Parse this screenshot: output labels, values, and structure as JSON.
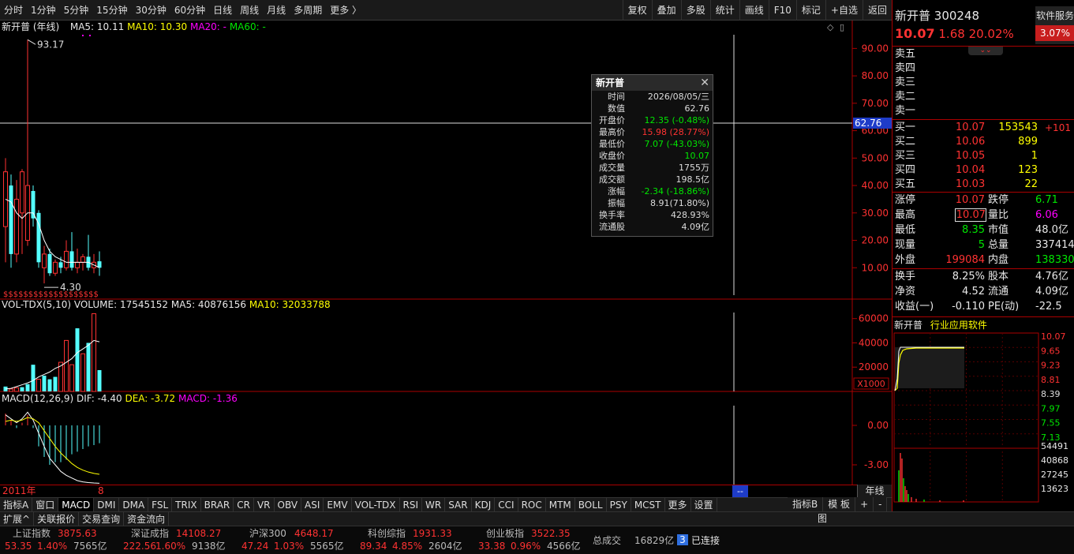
{
  "toolbar": {
    "left": [
      "分时",
      "1分钟",
      "5分钟",
      "15分钟",
      "30分钟",
      "60分钟",
      "日线",
      "周线",
      "月线",
      "多周期",
      "更多 〉"
    ],
    "right": [
      "复权",
      "叠加",
      "多股",
      "统计",
      "画线",
      "F10",
      "标记",
      "+自选",
      "返回"
    ]
  },
  "kline": {
    "title": "新开普 (年线)",
    "ma5": "MA5: 10.11",
    "ma10": "MA10: 10.30",
    "ma20": "MA20: -",
    "ma60": "MA60: -",
    "high_label": "93.17",
    "low_label": "4.30",
    "y_ticks": [
      "90.00",
      "80.00",
      "70.00",
      "60.00",
      "50.00",
      "40.00",
      "30.00",
      "20.00",
      "10.00"
    ],
    "crosshair_value": "62.76",
    "s_marks": "$$$$$$$$$$$$$$$$$$$"
  },
  "volume": {
    "title": "VOL-TDX(5,10)",
    "volume": "VOLUME: 17545152",
    "ma5": "MA5: 40876156",
    "ma10": "MA10: 32033788",
    "y_ticks": [
      "60000",
      "40000",
      "20000"
    ],
    "unit": "X1000"
  },
  "macd": {
    "title": "MACD(12,26,9)",
    "dif": "DIF: -4.40",
    "dea": "DEA: -3.72",
    "macd": "MACD: -1.36",
    "y_ticks": [
      "0.00",
      "-3.00"
    ]
  },
  "period": {
    "start_year": "2011年",
    "mid_label": "8",
    "cursor_label": "--",
    "period_button": "年线"
  },
  "tooltip": {
    "title": "新开普",
    "close": "✕",
    "rows": [
      {
        "k": "时间",
        "v": "2026/08/05/三",
        "c": "white"
      },
      {
        "k": "数值",
        "v": "62.76",
        "c": "white"
      },
      {
        "k": "开盘价",
        "v": "12.35 (-0.48%)",
        "c": "green"
      },
      {
        "k": "最高价",
        "v": "15.98 (28.77%)",
        "c": "red"
      },
      {
        "k": "最低价",
        "v": "7.07 (-43.03%)",
        "c": "green"
      },
      {
        "k": "收盘价",
        "v": "10.07",
        "c": "green"
      },
      {
        "k": "成交量",
        "v": "1755万",
        "c": "white"
      },
      {
        "k": "成交额",
        "v": "198.5亿",
        "c": "white"
      },
      {
        "k": "涨幅",
        "v": "-2.34 (-18.86%)",
        "c": "green"
      },
      {
        "k": "振幅",
        "v": "8.91(71.80%)",
        "c": "white"
      },
      {
        "k": "换手率",
        "v": "428.93%",
        "c": "white"
      },
      {
        "k": "流通股",
        "v": "4.09亿",
        "c": "white"
      }
    ]
  },
  "indicator_tabs": [
    "指标A",
    "窗口",
    "MACD",
    "DMI",
    "DMA",
    "FSL",
    "TRIX",
    "BRAR",
    "CR",
    "VR",
    "OBV",
    "ASI",
    "EMV",
    "VOL-TDX",
    "RSI",
    "WR",
    "SAR",
    "KDJ",
    "CCI",
    "ROC",
    "MTM",
    "BOLL",
    "PSY",
    "MCST",
    "更多",
    "设置"
  ],
  "indicator_right": [
    "指标B",
    "模 板",
    "+",
    "-"
  ],
  "bottom_tabs": [
    "扩展^",
    "关联报价",
    "交易查询",
    "资金流向"
  ],
  "bottom_icon": "图",
  "stock": {
    "name": "新开普",
    "code": "300248",
    "service": "软件服务",
    "service_pct": "3.07%",
    "price": "10.07",
    "change": "1.68",
    "change_pct": "20.02%"
  },
  "asks": [
    {
      "label": "卖五"
    },
    {
      "label": "卖四"
    },
    {
      "label": "卖三"
    },
    {
      "label": "卖二"
    },
    {
      "label": "卖一"
    }
  ],
  "bids": [
    {
      "label": "买一",
      "price": "10.07",
      "vol": "153543",
      "extra": "+101"
    },
    {
      "label": "买二",
      "price": "10.06",
      "vol": "899",
      "extra": ""
    },
    {
      "label": "买三",
      "price": "10.05",
      "vol": "1",
      "extra": ""
    },
    {
      "label": "买四",
      "price": "10.04",
      "vol": "123",
      "extra": ""
    },
    {
      "label": "买五",
      "price": "10.03",
      "vol": "22",
      "extra": ""
    }
  ],
  "stats": [
    {
      "k1": "涨停",
      "v1": "10.07",
      "c1": "red",
      "k2": "跌停",
      "v2": "6.71",
      "c2": "green"
    },
    {
      "k1": "最高",
      "v1": "10.07",
      "c1": "red",
      "k2": "量比",
      "v2": "6.06",
      "c2": "magenta"
    },
    {
      "k1": "最低",
      "v1": "8.35",
      "c1": "green",
      "k2": "市值",
      "v2": "48.0亿",
      "c2": "white"
    },
    {
      "k1": "现量",
      "v1": "5",
      "c1": "green",
      "k2": "总量",
      "v2": "337414",
      "c2": "white"
    },
    {
      "k1": "外盘",
      "v1": "199084",
      "c1": "red",
      "k2": "内盘",
      "v2": "138330",
      "c2": "green"
    }
  ],
  "stats2": [
    {
      "k1": "换手",
      "v1": "8.25%",
      "k2": "股本",
      "v2": "4.76亿"
    },
    {
      "k1": "净资",
      "v1": "4.52",
      "k2": "流通",
      "v2": "4.09亿"
    },
    {
      "k1": "收益(一)",
      "v1": "-0.110",
      "k2": "PE(动)",
      "v2": "-22.5"
    }
  ],
  "mini": {
    "name": "新开普",
    "industry": "行业应用软件",
    "price_ticks": [
      {
        "v": "10.07",
        "c": "red"
      },
      {
        "v": "9.65",
        "c": "red"
      },
      {
        "v": "9.23",
        "c": "red"
      },
      {
        "v": "8.81",
        "c": "red"
      },
      {
        "v": "8.39",
        "c": "white"
      },
      {
        "v": "7.97",
        "c": "green"
      },
      {
        "v": "7.55",
        "c": "green"
      },
      {
        "v": "7.13",
        "c": "green"
      }
    ],
    "vol_ticks": [
      "54491",
      "40868",
      "27245",
      "13623"
    ]
  },
  "indices": [
    {
      "name": "上证指数",
      "value": "3875.63",
      "chg": "53.35",
      "pct": "1.40%",
      "amt": "7565亿"
    },
    {
      "name": "深证成指",
      "value": "14108.27",
      "chg": "222.56",
      "pct": "1.60%",
      "amt": "9138亿"
    },
    {
      "name": "沪深300",
      "value": "4648.17",
      "chg": "47.24",
      "pct": "1.03%",
      "amt": "5565亿"
    },
    {
      "name": "科创综指",
      "value": "1931.33",
      "chg": "89.34",
      "pct": "4.85%",
      "amt": "2604亿"
    },
    {
      "name": "创业板指",
      "value": "3522.35",
      "chg": "33.38",
      "pct": "0.96%",
      "amt": "4566亿"
    }
  ],
  "total": {
    "label": "总成交",
    "value": "16829亿"
  },
  "connection": {
    "count": "3",
    "label": "已连接"
  },
  "chart_data": {
    "type": "candlestick",
    "price_range": [
      0,
      95
    ],
    "volume_range": [
      0,
      65000
    ],
    "macd_range": [
      -4.5,
      1.5
    ],
    "candles": [
      {
        "o": 25,
        "c": 45,
        "h": 50,
        "l": 12,
        "up": true
      },
      {
        "o": 40,
        "c": 15,
        "h": 44,
        "l": 10,
        "up": false
      },
      {
        "o": 15,
        "c": 35,
        "h": 42,
        "l": 12,
        "up": true
      },
      {
        "o": 30,
        "c": 45,
        "h": 46,
        "l": 15,
        "up": true
      },
      {
        "o": 20,
        "c": 40,
        "h": 93.17,
        "l": 18,
        "up": true
      },
      {
        "o": 38,
        "c": 28,
        "h": 40,
        "l": 25,
        "up": false
      },
      {
        "o": 30,
        "c": 12,
        "h": 31,
        "l": 10,
        "up": false
      },
      {
        "o": 10,
        "c": 15,
        "h": 18,
        "l": 4.3,
        "up": true
      },
      {
        "o": 15,
        "c": 8,
        "h": 17,
        "l": 7,
        "up": false
      },
      {
        "o": 8,
        "c": 12,
        "h": 13,
        "l": 7,
        "up": true
      },
      {
        "o": 12,
        "c": 10,
        "h": 14,
        "l": 8,
        "up": false
      },
      {
        "o": 10,
        "c": 16,
        "h": 20,
        "l": 9,
        "up": true
      },
      {
        "o": 16,
        "c": 10,
        "h": 23,
        "l": 9,
        "up": false
      },
      {
        "o": 10,
        "c": 12,
        "h": 17,
        "l": 8,
        "up": true
      },
      {
        "o": 12,
        "c": 14,
        "h": 15,
        "l": 9,
        "up": true
      },
      {
        "o": 14,
        "c": 10,
        "h": 22,
        "l": 9,
        "up": false
      },
      {
        "o": 10,
        "c": 12,
        "h": 15,
        "l": 8,
        "up": true
      },
      {
        "o": 10,
        "c": 12.35,
        "h": 15.98,
        "l": 7.07,
        "up": false
      }
    ],
    "ma5": [
      35,
      34,
      30,
      28,
      30,
      30,
      26,
      20,
      16,
      14,
      13,
      12,
      12,
      12,
      12,
      12,
      11,
      10.1
    ],
    "volumes": [
      {
        "v": 4000,
        "up": false
      },
      {
        "v": 2000,
        "up": true
      },
      {
        "v": 3000,
        "up": true
      },
      {
        "v": 3500,
        "up": false
      },
      {
        "v": 6000,
        "up": false
      },
      {
        "v": 22000,
        "up": false
      },
      {
        "v": 10000,
        "up": true
      },
      {
        "v": 13000,
        "up": false
      },
      {
        "v": 10000,
        "up": false
      },
      {
        "v": 12000,
        "up": false
      },
      {
        "v": 24000,
        "up": true
      },
      {
        "v": 42000,
        "up": true
      },
      {
        "v": 22000,
        "up": true
      },
      {
        "v": 52000,
        "up": false
      },
      {
        "v": 31000,
        "up": true
      },
      {
        "v": 40000,
        "up": false
      },
      {
        "v": 64000,
        "up": true
      },
      {
        "v": 17545,
        "up": false
      }
    ],
    "vol_ma5": [
      2000,
      2500,
      4000,
      5500,
      7000,
      9000,
      12000,
      14000,
      16000,
      19000,
      21000,
      24000,
      27000,
      32000,
      35000,
      38000,
      42000,
      40876
    ],
    "dif": [
      0.8,
      0.5,
      0.2,
      0.5,
      1.0,
      0.4,
      -0.6,
      -1.6,
      -2.5,
      -3.0,
      -3.5,
      -3.8,
      -4.0,
      -4.2,
      -4.3,
      -4.35,
      -4.38,
      -4.4
    ],
    "dea": [
      0.3,
      0.4,
      0.3,
      0.4,
      0.6,
      0.5,
      0.2,
      -0.4,
      -1.0,
      -1.6,
      -2.1,
      -2.5,
      -2.9,
      -3.2,
      -3.4,
      -3.55,
      -3.65,
      -3.72
    ],
    "macd_bars": [
      0.9,
      0.4,
      -0.2,
      0.2,
      0.8,
      -0.2,
      -1.6,
      -2.4,
      -3.0,
      -2.8,
      -2.8,
      -2.6,
      -2.2,
      -2.0,
      -1.8,
      -1.6,
      -1.5,
      -1.36
    ]
  }
}
